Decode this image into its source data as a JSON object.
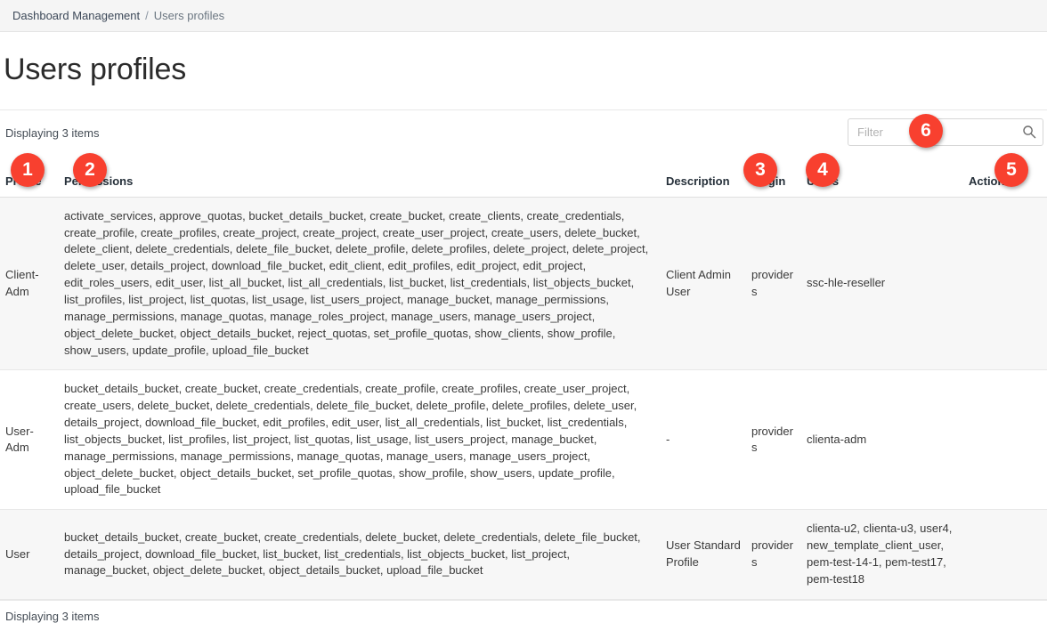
{
  "breadcrumb": {
    "parent": "Dashboard Management",
    "separator": "/",
    "current": "Users profiles"
  },
  "page": {
    "title": "Users profiles"
  },
  "toolbar": {
    "displaying_text": "Displaying 3 items",
    "filter_placeholder": "Filter",
    "filter_value": "",
    "search_icon": "search-icon"
  },
  "table": {
    "columns": [
      "Profile",
      "Permissions",
      "Description",
      "Origin",
      "Users",
      "Actions"
    ],
    "rows": [
      {
        "profile": "Client-Adm",
        "permissions": "activate_services, approve_quotas, bucket_details_bucket, create_bucket, create_clients, create_credentials, create_profile, create_profiles, create_project, create_project, create_user_project, create_users, delete_bucket, delete_client, delete_credentials, delete_file_bucket, delete_profile, delete_profiles, delete_project, delete_project, delete_user, details_project, download_file_bucket, edit_client, edit_profiles, edit_project, edit_project, edit_roles_users, edit_user, list_all_bucket, list_all_credentials, list_bucket, list_credentials, list_objects_bucket, list_profiles, list_project, list_quotas, list_usage, list_users_project, manage_bucket, manage_permissions, manage_permissions, manage_quotas, manage_roles_project, manage_users, manage_users_project, object_delete_bucket, object_details_bucket, reject_quotas, set_profile_quotas, show_clients, show_profile, show_users, update_profile, upload_file_bucket",
        "description": "Client Admin User",
        "origin": "providers",
        "users": "ssc-hle-reseller",
        "actions": ""
      },
      {
        "profile": "User-Adm",
        "permissions": "bucket_details_bucket, create_bucket, create_credentials, create_profile, create_profiles, create_user_project, create_users, delete_bucket, delete_credentials, delete_file_bucket, delete_profile, delete_profiles, delete_user, details_project, download_file_bucket, edit_profiles, edit_user, list_all_credentials, list_bucket, list_credentials, list_objects_bucket, list_profiles, list_project, list_quotas, list_usage, list_users_project, manage_bucket, manage_permissions, manage_permissions, manage_quotas, manage_users, manage_users_project, object_delete_bucket, object_details_bucket, set_profile_quotas, show_profile, show_users, update_profile, upload_file_bucket",
        "description": "-",
        "origin": "providers",
        "users": "clienta-adm",
        "actions": ""
      },
      {
        "profile": "User",
        "permissions": "bucket_details_bucket, create_bucket, create_credentials, delete_bucket, delete_credentials, delete_file_bucket, details_project, download_file_bucket, list_bucket, list_credentials, list_objects_bucket, list_project, manage_bucket, object_delete_bucket, object_details_bucket, upload_file_bucket",
        "description": "User Standard Profile",
        "origin": "providers",
        "users": "clienta-u2, clienta-u3, user4, new_template_client_user, pem-test-14-1, pem-test17, pem-test18",
        "actions": ""
      }
    ]
  },
  "footer": {
    "displaying_text": "Displaying 3 items"
  },
  "annotations": {
    "color": "#f8402f",
    "badges": [
      {
        "label": "1",
        "target": "profile-column"
      },
      {
        "label": "2",
        "target": "permissions-column"
      },
      {
        "label": "3",
        "target": "origin-column"
      },
      {
        "label": "4",
        "target": "users-column"
      },
      {
        "label": "5",
        "target": "actions-column"
      },
      {
        "label": "6",
        "target": "filter-input"
      }
    ]
  }
}
